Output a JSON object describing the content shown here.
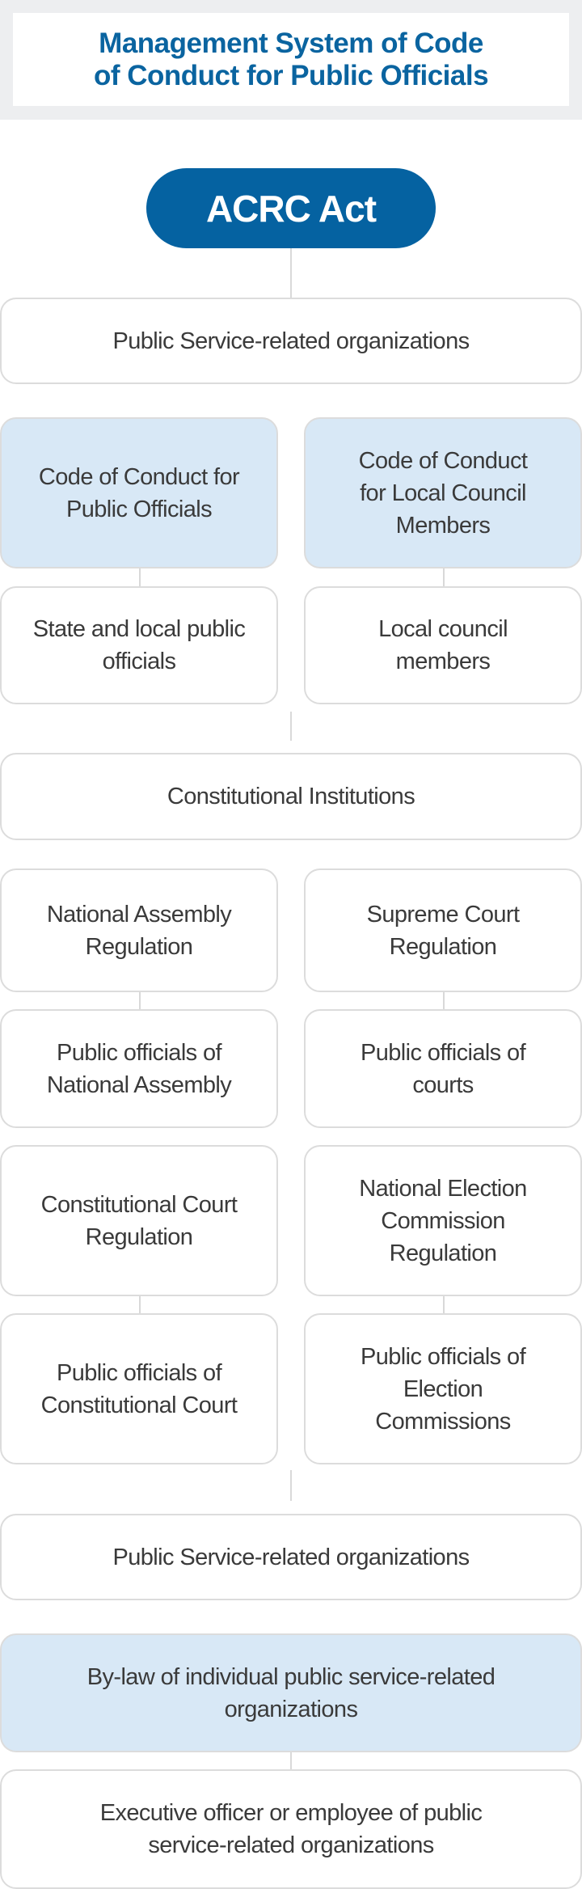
{
  "header": {
    "title": "Management System of Code\nof Conduct for Public Officials"
  },
  "root": {
    "label": "ACRC Act"
  },
  "nodes": {
    "psro_top": "Public Service-related organizations",
    "code_public_officials": "Code of Conduct for\nPublic Officials",
    "code_local_council": "Code of Conduct\nfor Local Council\nMembers",
    "state_local_officials": "State and local public\nofficials",
    "local_council_members": "Local council\nmembers",
    "constitutional_institutions": "Constitutional Institutions",
    "national_assembly_regulation": "National Assembly\nRegulation",
    "supreme_court_regulation": "Supreme Court\nRegulation",
    "officials_national_assembly": "Public officials of\nNational Assembly",
    "officials_courts": "Public officials of\ncourts",
    "constitutional_court_regulation": "Constitutional Court\nRegulation",
    "nec_regulation": "National Election\nCommission\nRegulation",
    "officials_constitutional_court": "Public officials of\nConstitutional Court",
    "officials_election_commissions": "Public officials of\nElection\nCommissions",
    "psro_bottom": "Public Service-related organizations",
    "bylaw": "By-law of individual public service-related\norganizations",
    "executive_officer": "Executive officer or employee of public\nservice-related organizations"
  }
}
